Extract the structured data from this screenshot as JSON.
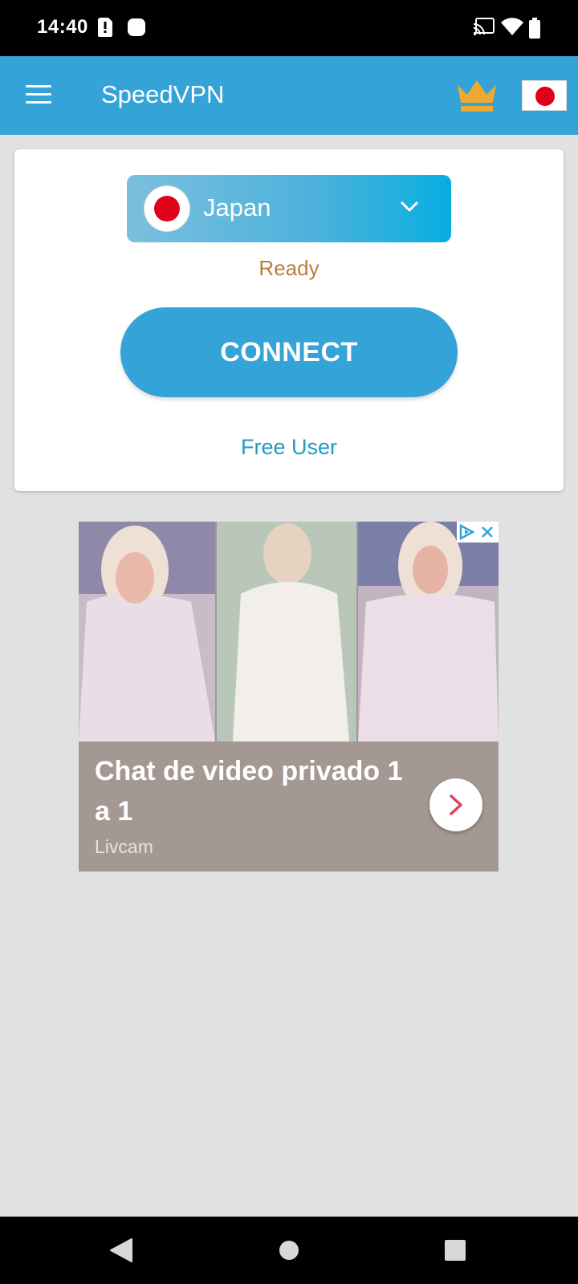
{
  "status_bar": {
    "time": "14:40",
    "icons": [
      "sim-alert-icon",
      "notification-icon",
      "cast-icon",
      "wifi-icon",
      "battery-icon"
    ]
  },
  "app_bar": {
    "title": "SpeedVPN",
    "menu_icon": "hamburger-menu-icon",
    "premium_icon": "crown-icon",
    "flag_icon": "japan-flag-icon"
  },
  "server": {
    "country": "Japan",
    "flag_icon": "japan-flag-icon",
    "dropdown_icon": "chevron-down-icon"
  },
  "connection": {
    "status": "Ready",
    "connect_label": "CONNECT",
    "user_type": "Free User"
  },
  "ad": {
    "headline": "Chat de video privado 1 a 1",
    "advertiser": "Livcam",
    "cta_icon": "chevron-right-icon"
  },
  "colors": {
    "primary": "#34a3d8",
    "status_ready": "#b87f3b",
    "user_type": "#1e9bc7",
    "crown": "#f0a830",
    "flag_red": "#e00018",
    "background": "#e1e1e1"
  },
  "nav_bar": {
    "buttons": [
      "back-icon",
      "home-icon",
      "recents-icon"
    ]
  }
}
